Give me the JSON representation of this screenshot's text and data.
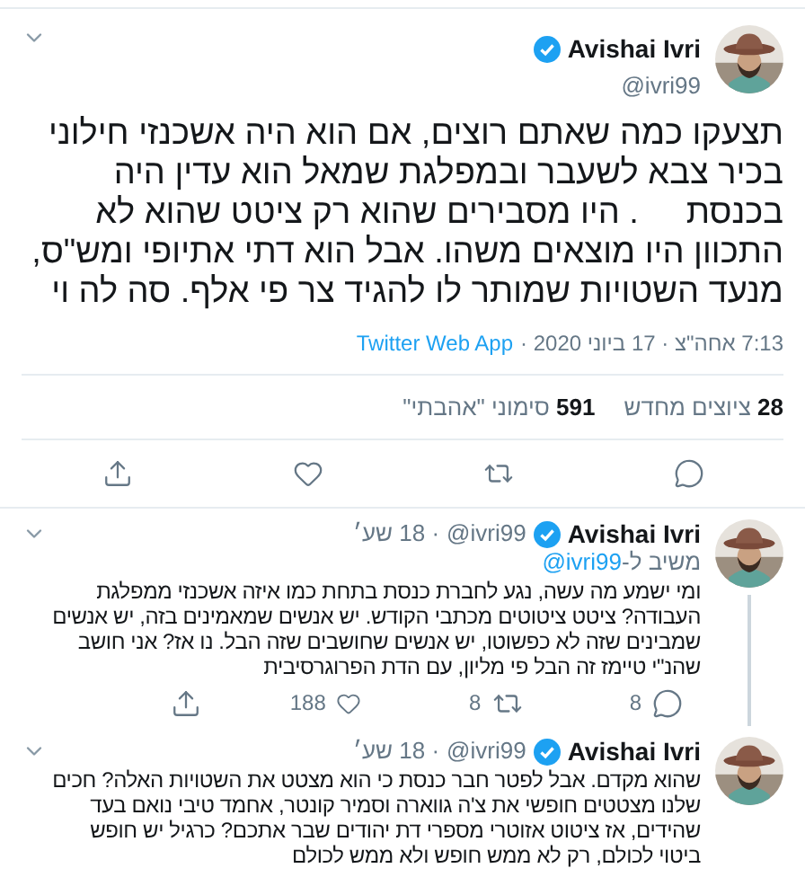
{
  "main_tweet": {
    "author": {
      "name": "Avishai Ivri",
      "handle": "@ivri99",
      "verified": true
    },
    "text_lines": [
      "תצעקו כמה שאתם רוצים, אם הוא היה אשכנזי חילוני",
      "בכיר צבא לשעבר ובמפלגת שמאל הוא עדין היה",
      "בכנסת     . היו מסבירים שהוא רק ציטט שהוא לא",
      "התכוון היו מוצאים משהו. אבל הוא דתי אתיופי ומש\"ס,",
      "מנעד השטויות שמותר לו להגיד צר פי אלף. סה לה וי"
    ],
    "timestamp": "7:13 אחה\"צ · 17 ביוני 2020 ·",
    "source": "Twitter Web App",
    "stats": [
      {
        "count": "28",
        "label": "ציוצים מחדש"
      },
      {
        "count": "591",
        "label": "סימוני \"אהבתי\""
      }
    ],
    "actions": [
      {
        "kind": "reply"
      },
      {
        "kind": "retweet"
      },
      {
        "kind": "like"
      },
      {
        "kind": "share"
      }
    ]
  },
  "replies": [
    {
      "author": {
        "name": "Avishai Ivri",
        "handle": "@ivri99",
        "verified": true
      },
      "age": "· 18 שע׳",
      "replying_to": {
        "prefix": "משיב ל-",
        "handle": "@ivri99"
      },
      "thread_line": true,
      "text_lines": [
        "ומי ישמע מה עשה, נגע לחברת כנסת בתחת כמו איזה אשכנזי ממפלגת",
        "העבודה? ציטט ציטוטים מכתבי הקודש. יש אנשים שמאמינים בזה, יש אנשים",
        "שמבינים שזה לא כפשוטו, יש אנשים שחושבים שזה הבל. נו אז? אני חושב",
        "שהנ\"י טיימז זה הבל פי מליון, עם הדת הפרוגרסיבית"
      ],
      "actions": [
        {
          "kind": "reply",
          "count": "8"
        },
        {
          "kind": "retweet",
          "count": "8"
        },
        {
          "kind": "like",
          "count": "188"
        },
        {
          "kind": "share"
        }
      ]
    },
    {
      "author": {
        "name": "Avishai Ivri",
        "handle": "@ivri99",
        "verified": true
      },
      "age": "· 18 שע׳",
      "thread_line": false,
      "text_lines": [
        "שהוא מקדם. אבל לפטר חבר כנסת כי הוא מצטט את השטויות האלה? חכים",
        "שלנו מצטטים חופשי את צ'ה גווארה וסמיר קונטר, אחמד טיבי נואם בעד",
        "שהידים, אז ציטוט אזוטרי מספרי דת יהודים שבר אתכם? כרגיל יש חופש",
        "ביטוי לכולם, רק לא ממש חופש ולא ממש לכולם"
      ]
    }
  ]
}
